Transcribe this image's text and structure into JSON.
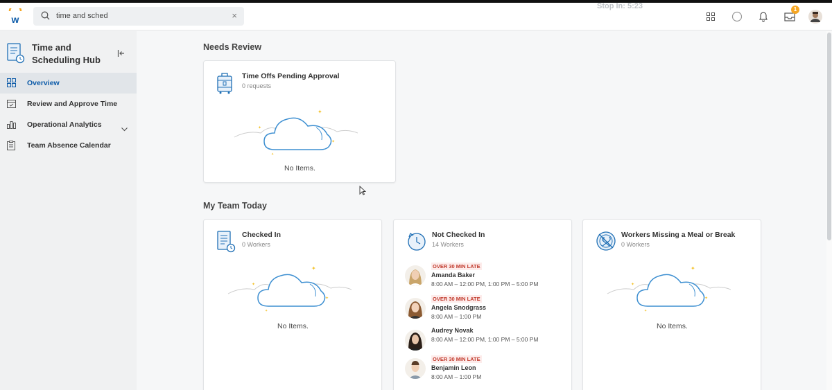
{
  "topbar": {
    "search_value": "time and sched",
    "clear_glyph": "×",
    "timer_text": "Stop In: 5:23",
    "inbox_badge": "1",
    "icons": [
      "workday-logo-icon",
      "search-icon",
      "apps-grid-icon",
      "chat-icon",
      "bell-icon",
      "inbox-icon",
      "profile-avatar"
    ],
    "accent": "#f5a623"
  },
  "sidebar": {
    "title": "Time and Scheduling Hub",
    "items": [
      {
        "label": "Overview",
        "icon": "dashboard-icon",
        "active": true
      },
      {
        "label": "Review and Approve Time",
        "icon": "calendar-check-icon"
      },
      {
        "label": "Operational Analytics",
        "icon": "bar-chart-icon",
        "expandable": true
      },
      {
        "label": "Team Absence Calendar",
        "icon": "clipboard-icon"
      }
    ],
    "active_color": "#0b5aa8"
  },
  "needs_review": {
    "title": "Needs Review",
    "card": {
      "title": "Time Offs Pending Approval",
      "subtitle": "0 requests",
      "empty": "No Items."
    }
  },
  "my_team": {
    "title": "My Team Today",
    "checked_in": {
      "title": "Checked In",
      "subtitle": "0 Workers",
      "empty": "No Items."
    },
    "not_checked_in": {
      "title": "Not Checked In",
      "subtitle": "14 Workers",
      "people": [
        {
          "badge": "OVER 30 MIN LATE",
          "name": "Amanda Baker",
          "time": "8:00 AM – 12:00 PM, 1:00 PM – 5:00 PM"
        },
        {
          "badge": "OVER 30 MIN LATE",
          "name": "Angela Snodgrass",
          "time": "8:00 AM – 1:00 PM"
        },
        {
          "badge": "",
          "name": "Audrey Novak",
          "time": "8:00 AM – 12:00 PM, 1:00 PM – 5:00 PM"
        },
        {
          "badge": "OVER 30 MIN LATE",
          "name": "Benjamin Leon",
          "time": "8:00 AM – 1:00 PM"
        }
      ]
    },
    "missing_meal": {
      "title": "Workers Missing a Meal or Break",
      "subtitle": "0 Workers",
      "empty": "No Items."
    }
  },
  "colors": {
    "icon_blue": "#1f6fb5",
    "late_red": "#c0392b",
    "cloud_blue": "#3d8fd1",
    "star_yellow": "#f4c430"
  }
}
